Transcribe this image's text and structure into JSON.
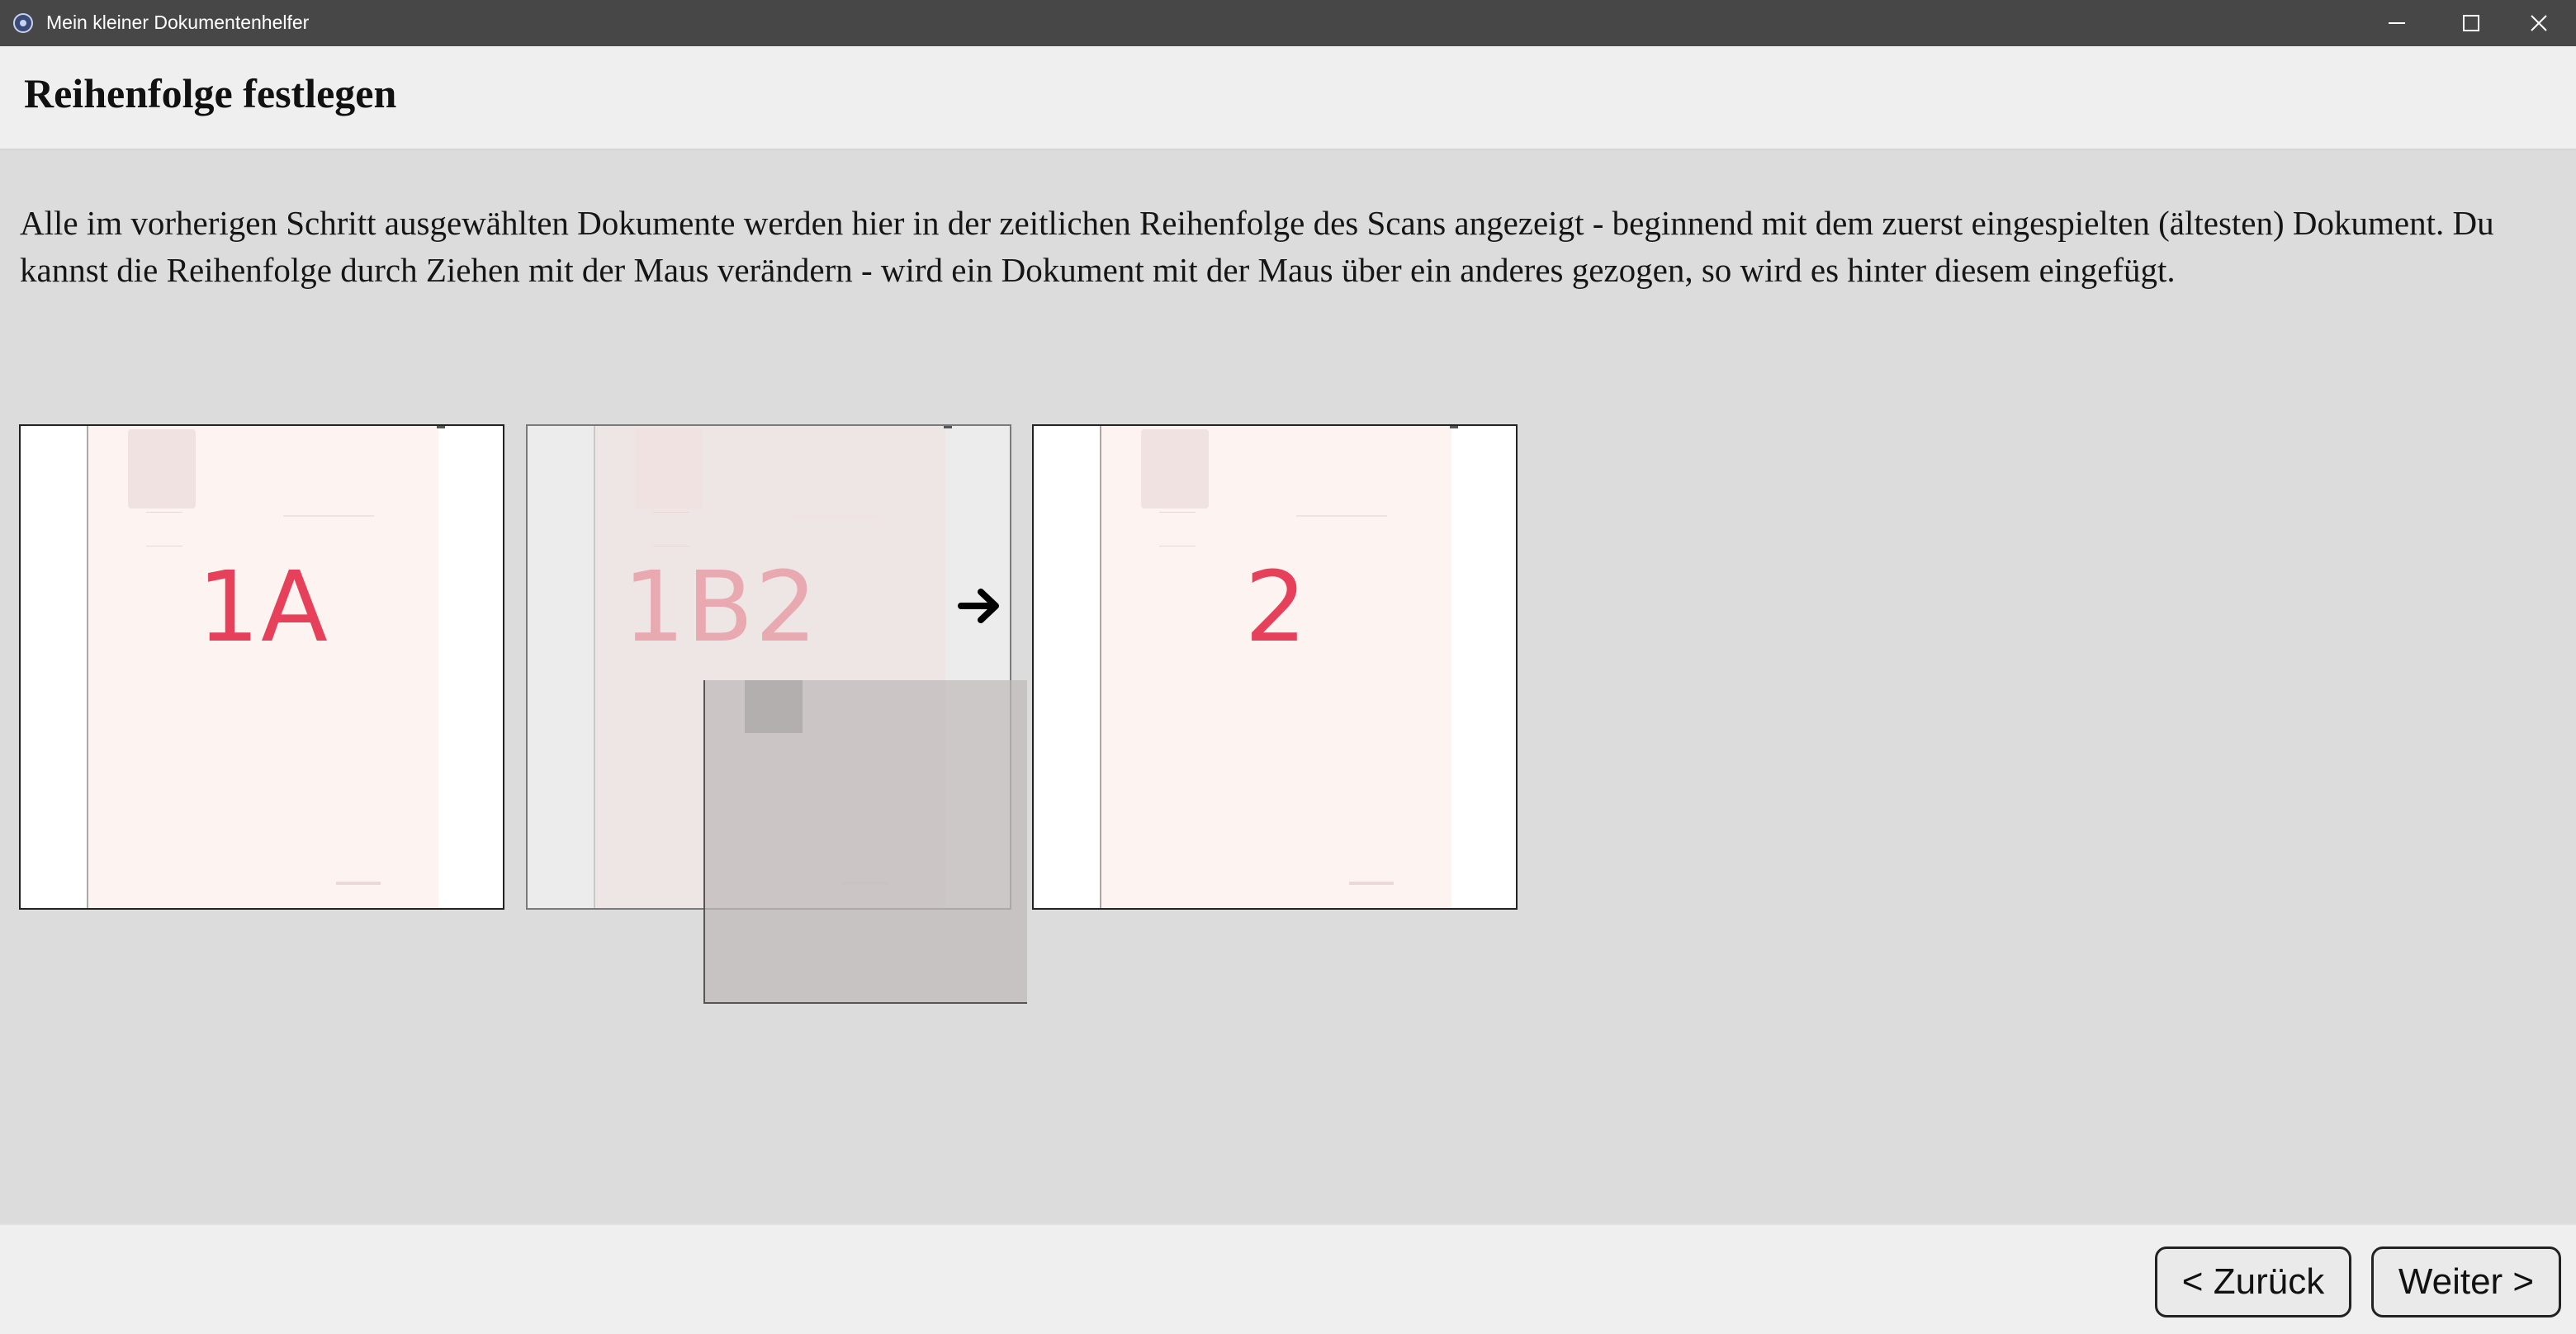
{
  "window": {
    "title": "Mein kleiner Dokumentenhelfer",
    "app_icon": "gear-icon",
    "controls": [
      "minimize-icon",
      "maximize-icon",
      "close-icon"
    ]
  },
  "header": {
    "title": "Reihenfolge festlegen"
  },
  "main": {
    "description": "Alle im vorherigen Schritt ausgewählten Dokumente werden hier in der zeitlichen Reihenfolge des Scans angezeigt - beginnend mit dem zuerst eingespielten (ältesten) Dokument. Du kannst die Reihenfolge durch Ziehen mit der Maus verändern - wird ein Dokument mit der Maus über ein anderes gezogen, so wird es hinter diesem eingefügt.",
    "documents": [
      {
        "label": "1A",
        "state": "normal"
      },
      {
        "label": "1B2",
        "state": "drop-target"
      },
      {
        "label": "2",
        "state": "normal"
      }
    ],
    "drop_indicator_icon": "arrow-right-icon"
  },
  "footer": {
    "back_label": "< Zurück",
    "next_label": "Weiter >"
  },
  "colors": {
    "titlebar": "#474747",
    "header": "#efefef",
    "content": "#dcdcdc",
    "handwriting": "#e6405a"
  }
}
